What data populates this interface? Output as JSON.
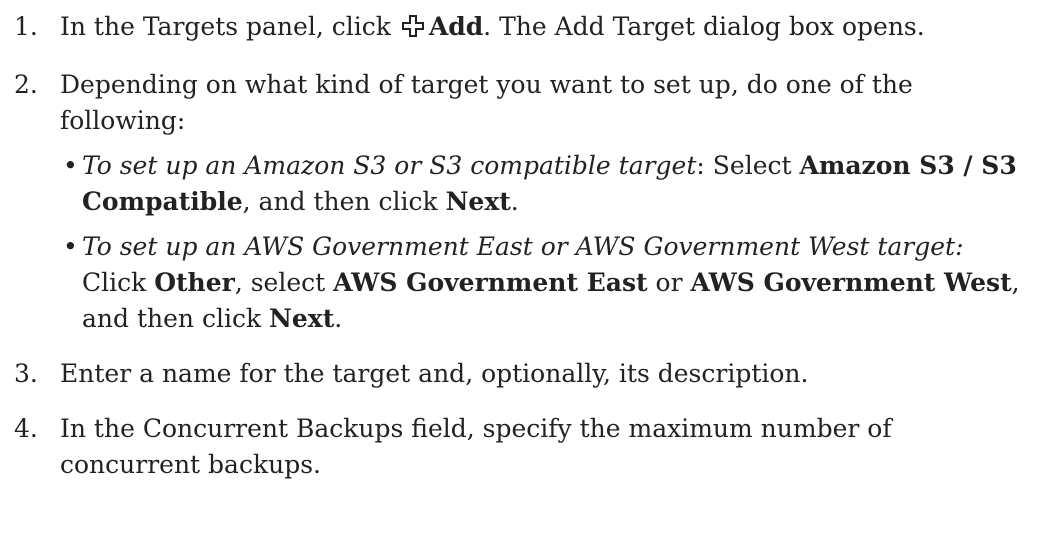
{
  "steps": [
    {
      "number": "1.",
      "prefix": "In the Targets panel, click",
      "add_label": "Add",
      "suffix": ". The Add Target dialog box opens."
    },
    {
      "number": "2.",
      "text": "Depending on what kind of target you want to set up, do one of the following:",
      "bullets": [
        {
          "italic": "To set up an Amazon S3 or S3 compatible target",
          "after_italic": ": Select ",
          "bold_1": "Amazon S3 / S3 Compatible",
          "mid_1": ", and then click ",
          "bold_2": "Next",
          "end": "."
        },
        {
          "italic": "To set up an AWS Government East or AWS Government West target:",
          "after_italic": " Click ",
          "bold_1": "Other",
          "mid_1": ", select ",
          "bold_2": "AWS Government East",
          "mid_2": " or ",
          "bold_3": "AWS Government West",
          "mid_3": ", and then click ",
          "bold_4": "Next",
          "end": "."
        }
      ]
    },
    {
      "number": "3.",
      "text": "Enter a name for the target and, optionally, its description."
    },
    {
      "number": "4.",
      "text": "In the Concurrent Backups field, specify the maximum number of concurrent backups."
    }
  ],
  "icons": {
    "add": "plus-icon"
  },
  "bullet_glyph": "•"
}
